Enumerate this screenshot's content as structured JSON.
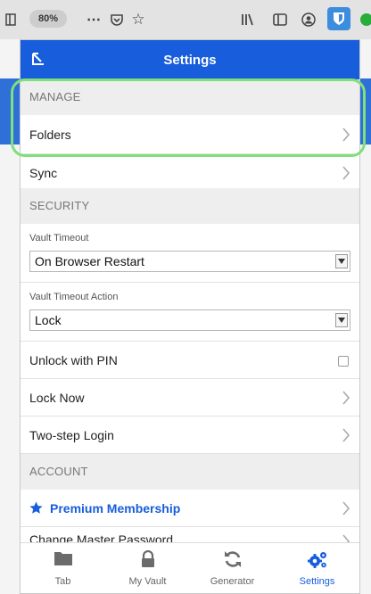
{
  "browser": {
    "zoom": "80%",
    "toolbar_icons": [
      "sidebar-toggle-icon",
      "more-icon",
      "pocket-icon",
      "star-icon",
      "library-icon",
      "sidebar-icon",
      "account-icon",
      "bitwarden-shield-icon"
    ]
  },
  "popup": {
    "title": "Settings",
    "sections": {
      "manage": "MANAGE",
      "security": "SECURITY",
      "account": "ACCOUNT"
    },
    "rows": {
      "folders": "Folders",
      "sync": "Sync",
      "vault_timeout_label": "Vault Timeout",
      "vault_timeout_value": "On Browser Restart",
      "vault_timeout_action_label": "Vault Timeout Action",
      "vault_timeout_action_value": "Lock",
      "unlock_pin": "Unlock with PIN",
      "lock_now": "Lock Now",
      "two_step": "Two-step Login",
      "premium": "Premium Membership",
      "change_master": "Change Master Password"
    },
    "tabs": [
      "Tab",
      "My Vault",
      "Generator",
      "Settings"
    ],
    "active_tab": "Settings"
  },
  "colors": {
    "brand": "#175ddc",
    "highlight": "#7ee07a",
    "section_bg": "#eeeeee"
  }
}
